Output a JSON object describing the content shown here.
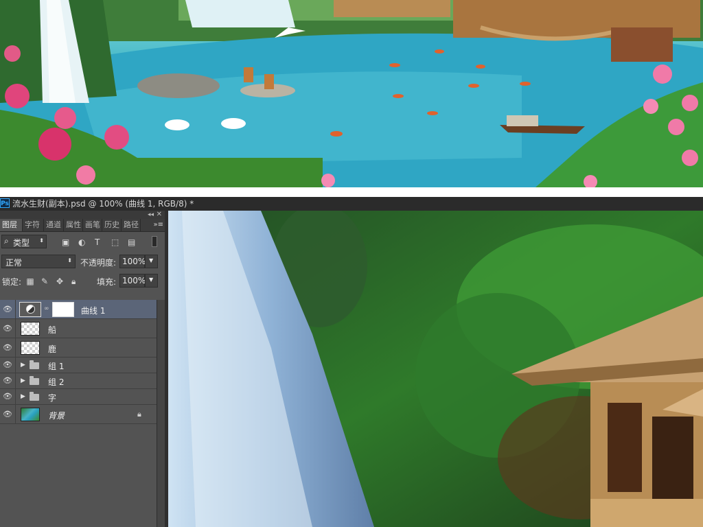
{
  "window": {
    "app_logo": "Ps",
    "document_title": "流水生财(副本).psd @ 100% (曲线 1, RGB/8) *"
  },
  "panel": {
    "tabs": [
      {
        "label": "图层",
        "active": true
      },
      {
        "label": "字符",
        "active": false
      },
      {
        "label": "通道",
        "active": false
      },
      {
        "label": "属性",
        "active": false
      },
      {
        "label": "画笔",
        "active": false
      },
      {
        "label": "历史",
        "active": false
      },
      {
        "label": "路径",
        "active": false
      }
    ],
    "filter": {
      "label": "类型",
      "icon": "search-icon"
    },
    "blend_mode": "正常",
    "opacity_label": "不透明度:",
    "opacity_value": "100%",
    "lock_label": "锁定:",
    "fill_label": "填充:",
    "fill_value": "100%",
    "layers": [
      {
        "name": "曲线 1",
        "type": "adjustment",
        "selected": true
      },
      {
        "name": "船",
        "type": "raster",
        "selected": false
      },
      {
        "name": "鹿",
        "type": "raster",
        "selected": false
      },
      {
        "name": "组 1",
        "type": "group",
        "selected": false
      },
      {
        "name": "组 2",
        "type": "group",
        "selected": false
      },
      {
        "name": "字",
        "type": "group",
        "selected": false
      },
      {
        "name": "背景",
        "type": "background",
        "selected": false,
        "locked": true
      }
    ]
  },
  "colors": {
    "panel_bg": "#535353",
    "titlebar_bg": "#2b2b2b",
    "selected_layer": "#5b6578",
    "water": "#2aa0c0"
  }
}
